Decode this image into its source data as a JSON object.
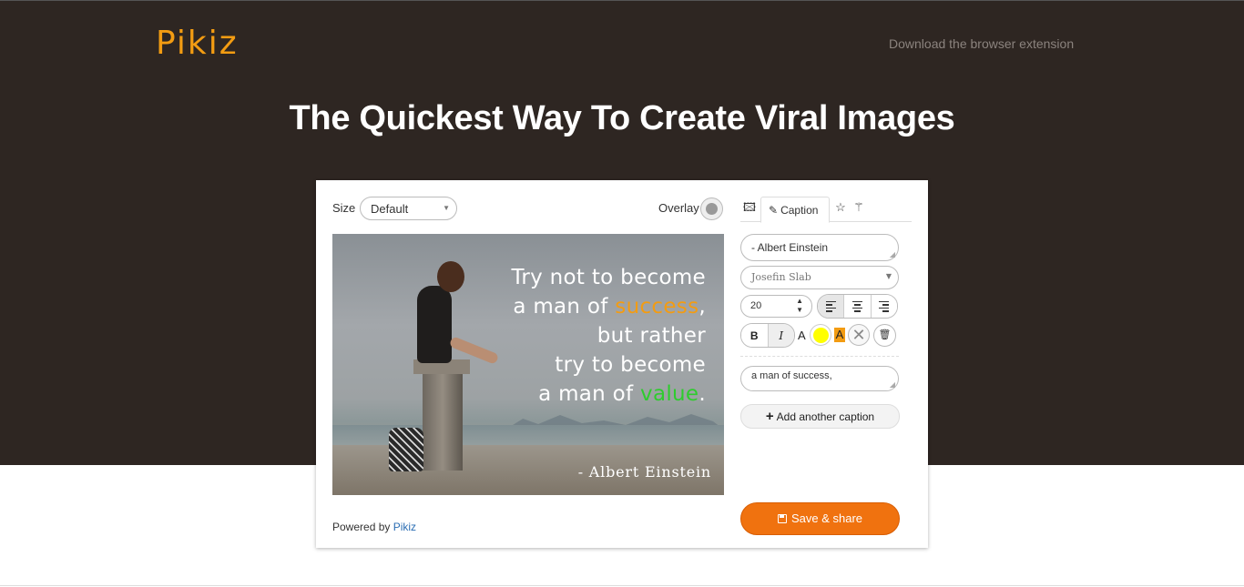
{
  "header": {
    "logo": "Pikiz",
    "extension_link": "Download the browser extension",
    "headline": "The Quickest Way To Create Viral Images"
  },
  "editor": {
    "size_label": "Size",
    "size_value": "Default",
    "overlay_label": "Overlay",
    "quote": {
      "line1": "Try not to become",
      "line2_pre": "a man of ",
      "line2_highlight": "success",
      "line2_post": ",",
      "line3": "but rather",
      "line4": "try to become",
      "line5_pre": "a man of ",
      "line5_highlight": "value",
      "line5_post": "."
    },
    "attribution": "- Albert Einstein",
    "powered_by": "Powered by",
    "powered_link": "Pikiz"
  },
  "panel": {
    "tabs": {
      "caption": "Caption"
    },
    "caption_text": "- Albert Einstein",
    "font": "Josefin Slab",
    "font_size": "20",
    "bold": "B",
    "italic": "I",
    "text_color_label": "A",
    "highlight_label": "A",
    "highlight_text": "a man of success,",
    "add_caption": "Add another caption",
    "save_share": "Save & share"
  },
  "colors": {
    "hero_bg": "#2e2622",
    "brand_orange": "#f39c12",
    "save_orange": "#f0720f",
    "highlight_green": "#2ecc2e",
    "text_color_yellow": "#ffff00",
    "link_blue": "#2a6db3"
  },
  "icons": [
    "image-icon",
    "pencil-icon",
    "star-icon",
    "magic-wand-icon",
    "align-left-icon",
    "align-center-icon",
    "align-right-icon",
    "trash-icon",
    "no-color-icon",
    "plus-icon",
    "floppy-disk-icon"
  ]
}
